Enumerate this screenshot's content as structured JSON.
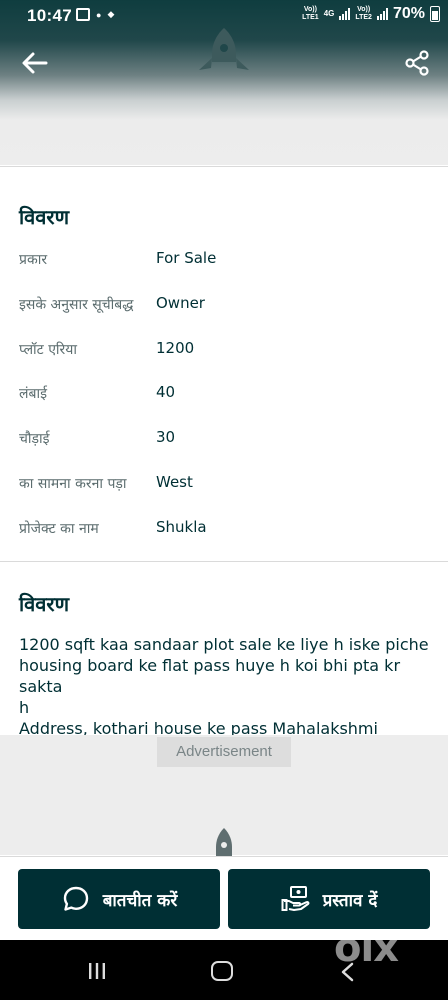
{
  "status_bar": {
    "time": "10:47",
    "sim1_label_top": "Vo))",
    "sim1_label_mid": "4G",
    "sim1_label_bottom": "LTE1",
    "sim2_label_top": "Vo))",
    "sim2_label_bottom": "LTE2",
    "battery": "70%"
  },
  "header": {
    "back_icon": "arrow-left-icon",
    "share_icon": "share-icon"
  },
  "details": {
    "title": "विवरण",
    "rows": [
      {
        "label": "प्रकार",
        "value": "For Sale"
      },
      {
        "label": "इसके अनुसार सूचीबद्ध",
        "value": "Owner"
      },
      {
        "label": "प्लॉट एरिया",
        "value": "1200"
      },
      {
        "label": "लंबाई",
        "value": "40"
      },
      {
        "label": "चौड़ाई",
        "value": "30"
      },
      {
        "label": "का सामना करना पड़ा",
        "value": "West"
      },
      {
        "label": "प्रोजेक्ट का नाम",
        "value": "Shukla"
      }
    ]
  },
  "description": {
    "title": "विवरण",
    "lines": [
      "1200 sqft kaa sandaar plot sale ke liye h iske piche",
      "housing board ke flat pass huye h koi bhi pta kr sakta",
      "h",
      "Address,  kothari house ke pass Mahalakshmi Nagar,"
    ]
  },
  "ad": {
    "label": "Advertisement"
  },
  "actions": {
    "chat_label": "बातचीत करें",
    "offer_label": "प्रस्ताव दें"
  },
  "watermark": "olx",
  "colors": {
    "primary": "#002f34",
    "muted": "#5b6c6e"
  }
}
